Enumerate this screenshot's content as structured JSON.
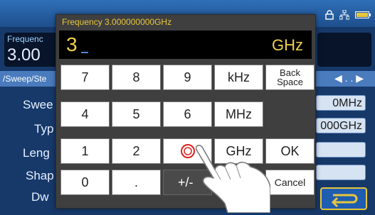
{
  "background": {
    "freq_title": "Frequenc",
    "freq_value": "3.00",
    "breadcrumb": "/Sweep/Ste",
    "params": [
      "Swee",
      "Typ",
      "Leng",
      "Shap",
      "Dw"
    ],
    "fields": [
      "0MHz",
      "000GHz",
      "",
      ""
    ],
    "nav": "◀ . . ▶"
  },
  "dialog": {
    "title": "Frequency 3.000000000GHz",
    "entry_value": "3",
    "entry_unit": "GHz"
  },
  "keys": {
    "k7": "7",
    "k8": "8",
    "k9": "9",
    "khz": "kHz",
    "backspace_1": "Back",
    "backspace_2": "Space",
    "k4": "4",
    "k5": "5",
    "k6": "6",
    "mhz": "MHz",
    "k1": "1",
    "k2": "2",
    "k3": "",
    "ghz": "GHz",
    "ok": "OK",
    "k0": "0",
    "dot": ".",
    "plusminus": "+/-",
    "cancel": "Cancel"
  },
  "colors": {
    "accent": "#e6c63d",
    "entry_text": "#f0d050",
    "touch_ring": "#e02020"
  }
}
